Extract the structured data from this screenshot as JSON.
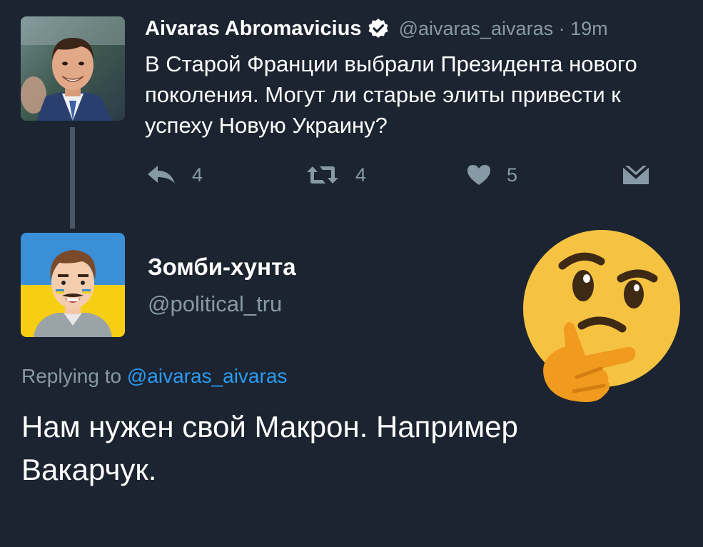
{
  "parent_tweet": {
    "author_name": "Aivaras Abromavicius",
    "handle_time": "@aivaras_aivaras · 19m",
    "text": "В Старой Франции выбрали Президента нового поколения. Могут ли старые элиты привести к успеху Новую Украину?",
    "actions": {
      "reply": {
        "icon": "reply-icon",
        "count": "4"
      },
      "retweet": {
        "icon": "retweet-icon",
        "count": "4"
      },
      "like": {
        "icon": "heart-icon",
        "count": "5"
      },
      "dm": {
        "icon": "envelope-icon"
      }
    }
  },
  "reply_tweet": {
    "author_name": "Зомби-хунта",
    "handle": "@political_tru",
    "replying_prefix": "Replying to",
    "replying_mention": "@aivaras_aivaras",
    "text": "Нам нужен свой Макрон. Например Вакарчук."
  },
  "overlay": {
    "icon": "thinking-face-emoji"
  },
  "colors": {
    "background": "#1b2430",
    "muted": "#8899a6",
    "link": "#2b9bf0",
    "thread_line": "#4a5665",
    "text": "#ffffff"
  }
}
